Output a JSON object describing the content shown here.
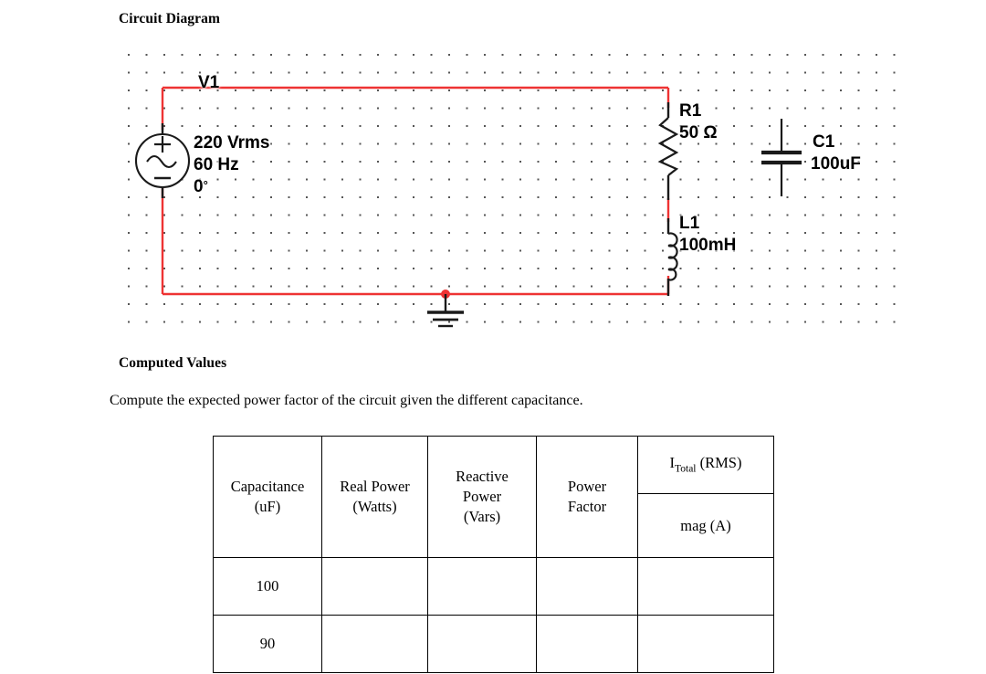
{
  "headings": {
    "circuit_diagram": "Circuit Diagram",
    "computed_values": "Computed Values"
  },
  "instruction": "Compute the expected power factor of the circuit given the different capacitance.",
  "circuit": {
    "wire_color": "#ee3333",
    "source": {
      "ref": "V1",
      "voltage": "220 Vrms",
      "frequency": "60 Hz",
      "phase": "0",
      "phase_unit": "°",
      "plus_sign": "+",
      "minus_sign": "−"
    },
    "resistor": {
      "ref": "R1",
      "value": "50 Ω"
    },
    "inductor": {
      "ref": "L1",
      "value": "100mH"
    },
    "capacitor": {
      "ref": "C1",
      "value": "100uF"
    },
    "ground": "ground-symbol"
  },
  "table": {
    "headers": {
      "capacitance": "Capacitance",
      "capacitance_unit": "(uF)",
      "real_power": "Real Power",
      "real_power_unit": "(Watts)",
      "reactive_power_l1": "Reactive",
      "reactive_power_l2": "Power",
      "reactive_power_unit": "(Vars)",
      "power_factor_l1": "Power",
      "power_factor_l2": "Factor",
      "itotal_symbol": "I",
      "itotal_sub": "Total",
      "itotal_rms": "(RMS)",
      "itotal_mag": "mag (A)"
    },
    "rows": [
      {
        "capacitance": "100",
        "real_power": "",
        "reactive_power": "",
        "power_factor": "",
        "itotal_mag": ""
      },
      {
        "capacitance": "90",
        "real_power": "",
        "reactive_power": "",
        "power_factor": "",
        "itotal_mag": ""
      }
    ]
  }
}
